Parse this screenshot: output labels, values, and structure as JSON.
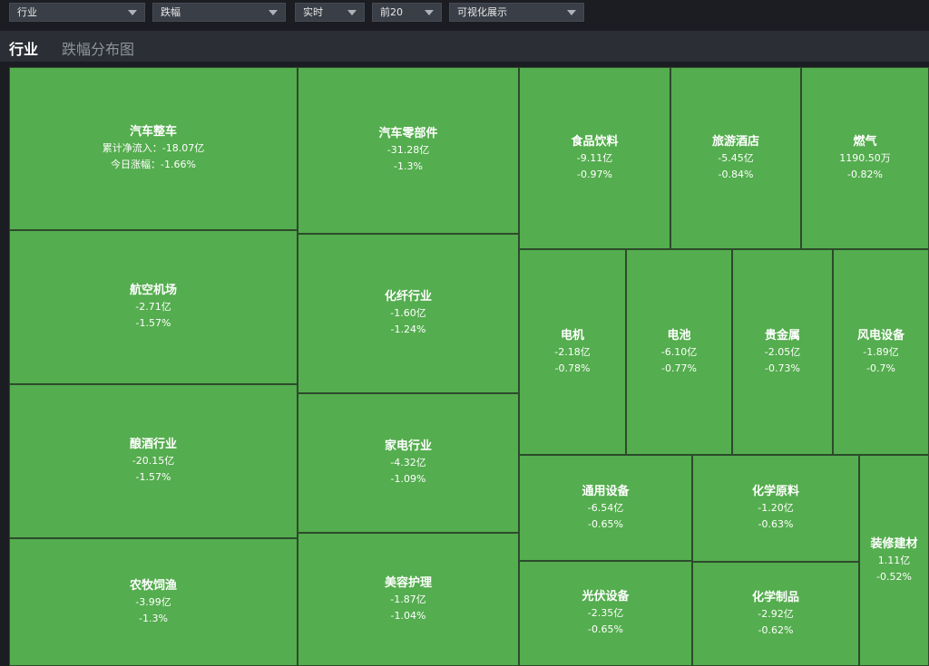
{
  "toolbar": {
    "dropdowns": [
      {
        "value": "行业"
      },
      {
        "value": "跌幅"
      },
      {
        "value": "实时"
      },
      {
        "value": "前20"
      },
      {
        "value": "可视化展示"
      }
    ]
  },
  "tabs": {
    "active": "行业",
    "secondary": "跌幅分布图"
  },
  "colors": {
    "tile_fill": "#54ad4e",
    "tile_border": "#2d4a2c",
    "background": "#1b1d22"
  },
  "tiles": [
    {
      "name": "汽车整车",
      "value": "累计净流入：-18.07亿",
      "change": "今日涨幅：-1.66%"
    },
    {
      "name": "航空机场",
      "value": "-2.71亿",
      "change": "-1.57%"
    },
    {
      "name": "酿酒行业",
      "value": "-20.15亿",
      "change": "-1.57%"
    },
    {
      "name": "农牧饲渔",
      "value": "-3.99亿",
      "change": "-1.3%"
    },
    {
      "name": "汽车零部件",
      "value": "-31.28亿",
      "change": "-1.3%"
    },
    {
      "name": "化纤行业",
      "value": "-1.60亿",
      "change": "-1.24%"
    },
    {
      "name": "家电行业",
      "value": "-4.32亿",
      "change": "-1.09%"
    },
    {
      "name": "美容护理",
      "value": "-1.87亿",
      "change": "-1.04%"
    },
    {
      "name": "食品饮料",
      "value": "-9.11亿",
      "change": "-0.97%"
    },
    {
      "name": "旅游酒店",
      "value": "-5.45亿",
      "change": "-0.84%"
    },
    {
      "name": "燃气",
      "value": "1190.50万",
      "change": "-0.82%"
    },
    {
      "name": "电机",
      "value": "-2.18亿",
      "change": "-0.78%"
    },
    {
      "name": "电池",
      "value": "-6.10亿",
      "change": "-0.77%"
    },
    {
      "name": "贵金属",
      "value": "-2.05亿",
      "change": "-0.73%"
    },
    {
      "name": "风电设备",
      "value": "-1.89亿",
      "change": "-0.7%"
    },
    {
      "name": "通用设备",
      "value": "-6.54亿",
      "change": "-0.65%"
    },
    {
      "name": "化学原料",
      "value": "-1.20亿",
      "change": "-0.63%"
    },
    {
      "name": "装修建材",
      "value": "1.11亿",
      "change": "-0.52%"
    },
    {
      "name": "光伏设备",
      "value": "-2.35亿",
      "change": "-0.65%"
    },
    {
      "name": "化学制品",
      "value": "-2.92亿",
      "change": "-0.62%"
    }
  ]
}
